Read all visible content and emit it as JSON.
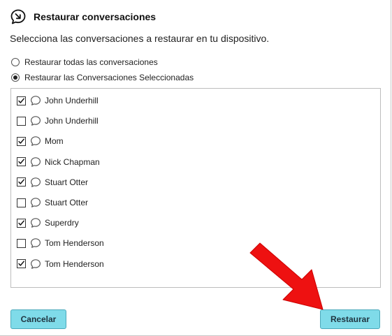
{
  "dialog": {
    "title": "Restaurar conversaciones",
    "instruction": "Selecciona las conversaciones a restaurar en tu dispositivo."
  },
  "options": {
    "all_label": "Restaurar todas las conversaciones",
    "all_selected": false,
    "selected_label": "Restaurar las Conversaciones Seleccionadas",
    "selected_selected": true
  },
  "conversations": [
    {
      "name": "John Underhill",
      "checked": true
    },
    {
      "name": "John Underhill",
      "checked": false
    },
    {
      "name": "Mom",
      "checked": true
    },
    {
      "name": "Nick Chapman",
      "checked": true
    },
    {
      "name": "Stuart Otter",
      "checked": true
    },
    {
      "name": "Stuart Otter",
      "checked": false
    },
    {
      "name": "Superdry",
      "checked": true
    },
    {
      "name": "Tom Henderson",
      "checked": false
    },
    {
      "name": "Tom Henderson",
      "checked": true
    }
  ],
  "buttons": {
    "cancel_label": "Cancelar",
    "restore_label": "Restaurar"
  },
  "colors": {
    "button_bg": "#7fdbe9",
    "annotation_arrow": "#ee1111"
  },
  "icons": {
    "header": "chat-restore-icon",
    "item": "chat-bubble-icon"
  }
}
